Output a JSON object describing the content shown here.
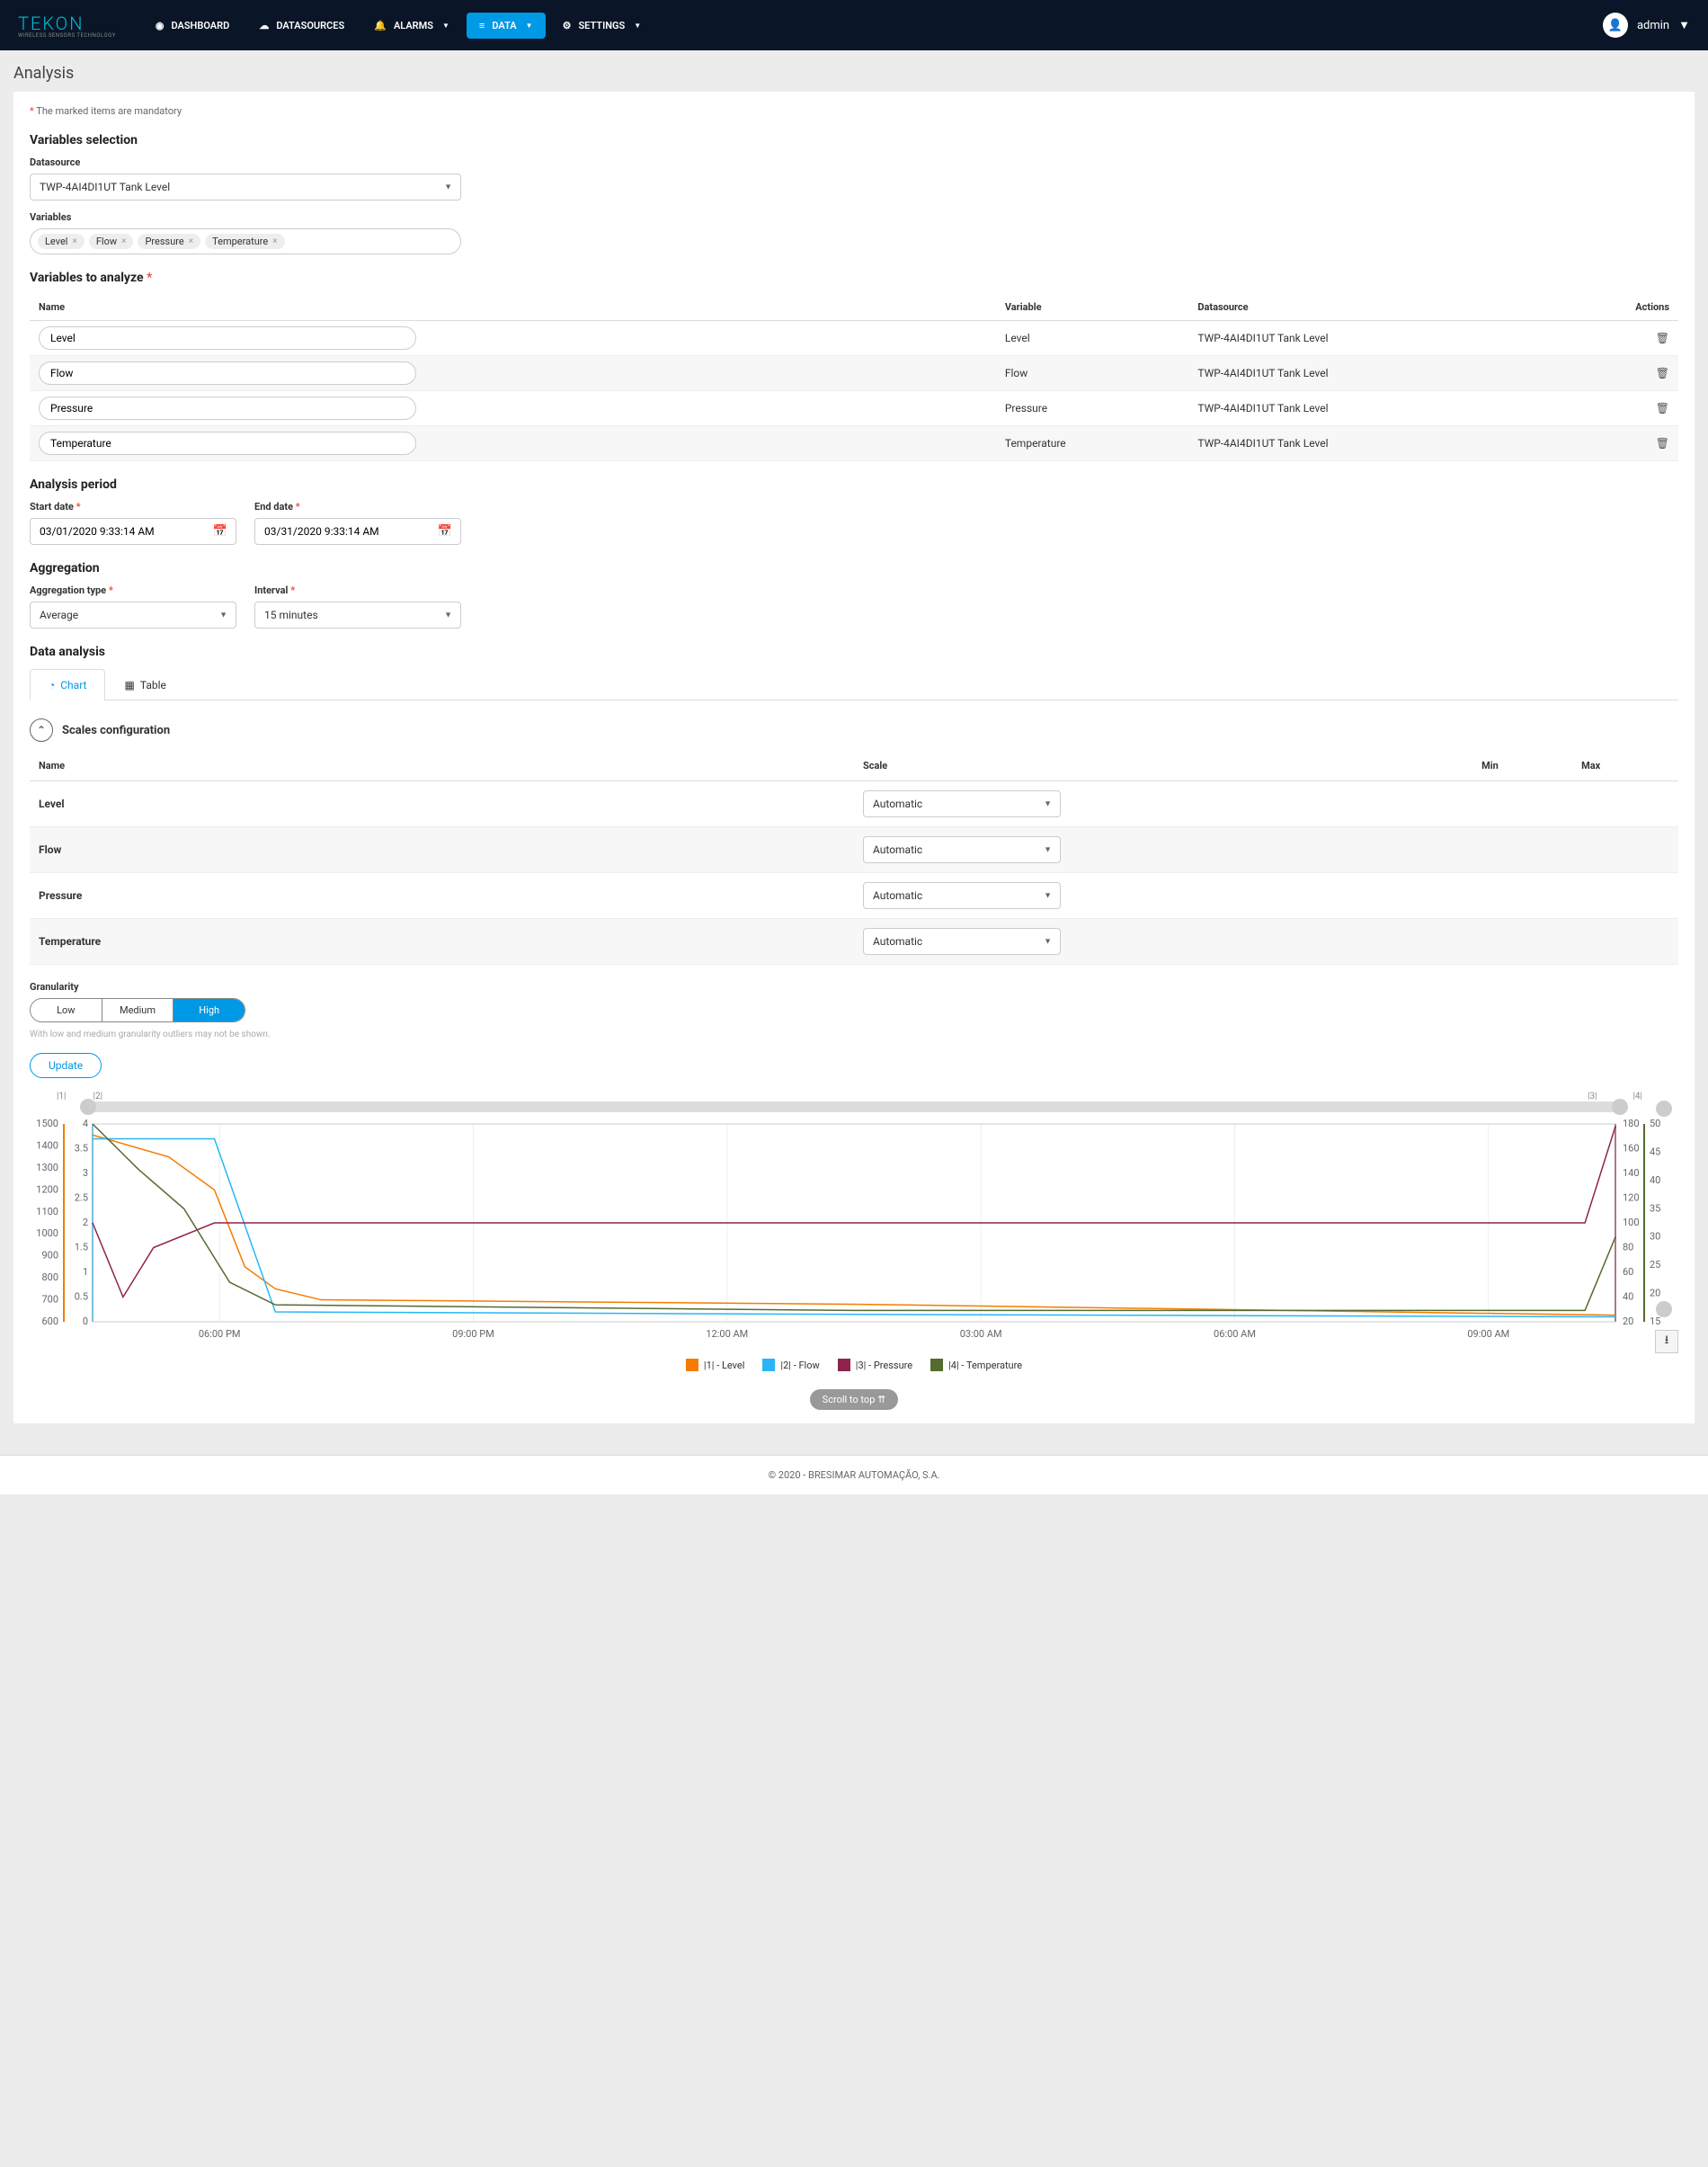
{
  "nav": {
    "logo": "TEKON",
    "logoSub": "WIRELESS SENSORS TECHNOLOGY",
    "items": [
      {
        "label": "DASHBOARD",
        "icon": "dashboard"
      },
      {
        "label": "DATASOURCES",
        "icon": "datasource"
      },
      {
        "label": "ALARMS",
        "icon": "bell",
        "caret": true
      },
      {
        "label": "DATA",
        "icon": "data",
        "caret": true,
        "active": true
      },
      {
        "label": "SETTINGS",
        "icon": "gear",
        "caret": true
      }
    ],
    "user": "admin"
  },
  "page": {
    "title": "Analysis",
    "mandatory": "The marked items are mandatory"
  },
  "varsel": {
    "heading": "Variables selection",
    "dsLabel": "Datasource",
    "dsValue": "TWP-4AI4DI1UT Tank Level",
    "varLabel": "Variables",
    "tags": [
      "Level",
      "Flow",
      "Pressure",
      "Temperature"
    ]
  },
  "analyze": {
    "heading": "Variables to analyze",
    "cols": {
      "name": "Name",
      "variable": "Variable",
      "datasource": "Datasource",
      "actions": "Actions"
    },
    "rows": [
      {
        "name": "Level",
        "variable": "Level",
        "ds": "TWP-4AI4DI1UT Tank Level"
      },
      {
        "name": "Flow",
        "variable": "Flow",
        "ds": "TWP-4AI4DI1UT Tank Level"
      },
      {
        "name": "Pressure",
        "variable": "Pressure",
        "ds": "TWP-4AI4DI1UT Tank Level"
      },
      {
        "name": "Temperature",
        "variable": "Temperature",
        "ds": "TWP-4AI4DI1UT Tank Level"
      }
    ]
  },
  "period": {
    "heading": "Analysis period",
    "startLabel": "Start date",
    "startValue": "03/01/2020 9:33:14 AM",
    "endLabel": "End date",
    "endValue": "03/31/2020 9:33:14 AM"
  },
  "agg": {
    "heading": "Aggregation",
    "typeLabel": "Aggregation type",
    "typeValue": "Average",
    "intLabel": "Interval",
    "intValue": "15 minutes"
  },
  "dataAnalysis": {
    "heading": "Data analysis",
    "tabs": {
      "chart": "Chart",
      "table": "Table"
    }
  },
  "scales": {
    "heading": "Scales configuration",
    "cols": {
      "name": "Name",
      "scale": "Scale",
      "min": "Min",
      "max": "Max"
    },
    "rows": [
      {
        "name": "Level",
        "scale": "Automatic"
      },
      {
        "name": "Flow",
        "scale": "Automatic"
      },
      {
        "name": "Pressure",
        "scale": "Automatic"
      },
      {
        "name": "Temperature",
        "scale": "Automatic"
      }
    ]
  },
  "gran": {
    "label": "Granularity",
    "opts": {
      "low": "Low",
      "med": "Medium",
      "high": "High"
    },
    "hint": "With low and medium granularity outliers may not be shown."
  },
  "update": "Update",
  "chart_data": {
    "type": "line",
    "x_ticks": [
      "06:00 PM",
      "09:00 PM",
      "12:00 AM",
      "03:00 AM",
      "06:00 AM",
      "09:00 AM"
    ],
    "axes": [
      {
        "id": "|1|",
        "label": "Level",
        "side": "left",
        "color": "#f57c00",
        "range": [
          600,
          1500
        ],
        "ticks": [
          600,
          700,
          800,
          900,
          1000,
          1100,
          1200,
          1300,
          1400,
          1500
        ]
      },
      {
        "id": "|2|",
        "label": "Flow",
        "side": "left",
        "color": "#29b6f6",
        "range": [
          0,
          4
        ],
        "ticks": [
          0,
          0.5,
          1,
          1.5,
          2,
          2.5,
          3,
          3.5,
          4
        ]
      },
      {
        "id": "|3|",
        "label": "Pressure",
        "side": "right",
        "color": "#8e244d",
        "range": [
          20,
          180
        ],
        "ticks": [
          20,
          40,
          60,
          80,
          100,
          120,
          140,
          160,
          180
        ]
      },
      {
        "id": "|4|",
        "label": "Temperature",
        "side": "right",
        "color": "#556b2f",
        "range": [
          15,
          50
        ],
        "ticks": [
          15,
          20,
          25,
          30,
          35,
          40,
          45,
          50
        ]
      }
    ],
    "series": [
      {
        "name": "|1| - Level",
        "color": "#f57c00",
        "axis": "|1|",
        "points": [
          [
            0,
            1450
          ],
          [
            0.05,
            1350
          ],
          [
            0.08,
            1200
          ],
          [
            0.1,
            850
          ],
          [
            0.12,
            750
          ],
          [
            0.15,
            700
          ],
          [
            0.5,
            680
          ],
          [
            1.0,
            630
          ]
        ]
      },
      {
        "name": "|2| - Flow",
        "color": "#29b6f6",
        "axis": "|2|",
        "points": [
          [
            0,
            3.7
          ],
          [
            0.05,
            3.7
          ],
          [
            0.08,
            3.7
          ],
          [
            0.12,
            0.2
          ],
          [
            0.5,
            0.15
          ],
          [
            1.0,
            0.1
          ]
        ]
      },
      {
        "name": "|3| - Pressure",
        "color": "#8e244d",
        "axis": "|3|",
        "points": [
          [
            0,
            100
          ],
          [
            0.02,
            40
          ],
          [
            0.04,
            80
          ],
          [
            0.08,
            100
          ],
          [
            0.12,
            100
          ],
          [
            0.98,
            100
          ],
          [
            1.0,
            178
          ]
        ]
      },
      {
        "name": "|4| - Temperature",
        "color": "#556b2f",
        "axis": "|4|",
        "points": [
          [
            0,
            50
          ],
          [
            0.03,
            42
          ],
          [
            0.06,
            35
          ],
          [
            0.09,
            22
          ],
          [
            0.12,
            18
          ],
          [
            0.5,
            17
          ],
          [
            0.98,
            17
          ],
          [
            1.0,
            30
          ]
        ]
      }
    ],
    "legend": [
      "|1| - Level",
      "|2| - Flow",
      "|3| - Pressure",
      "|4| - Temperature"
    ]
  },
  "scrollTop": "Scroll to top",
  "footer": "© 2020 - BRESIMAR AUTOMAÇÃO, S.A."
}
